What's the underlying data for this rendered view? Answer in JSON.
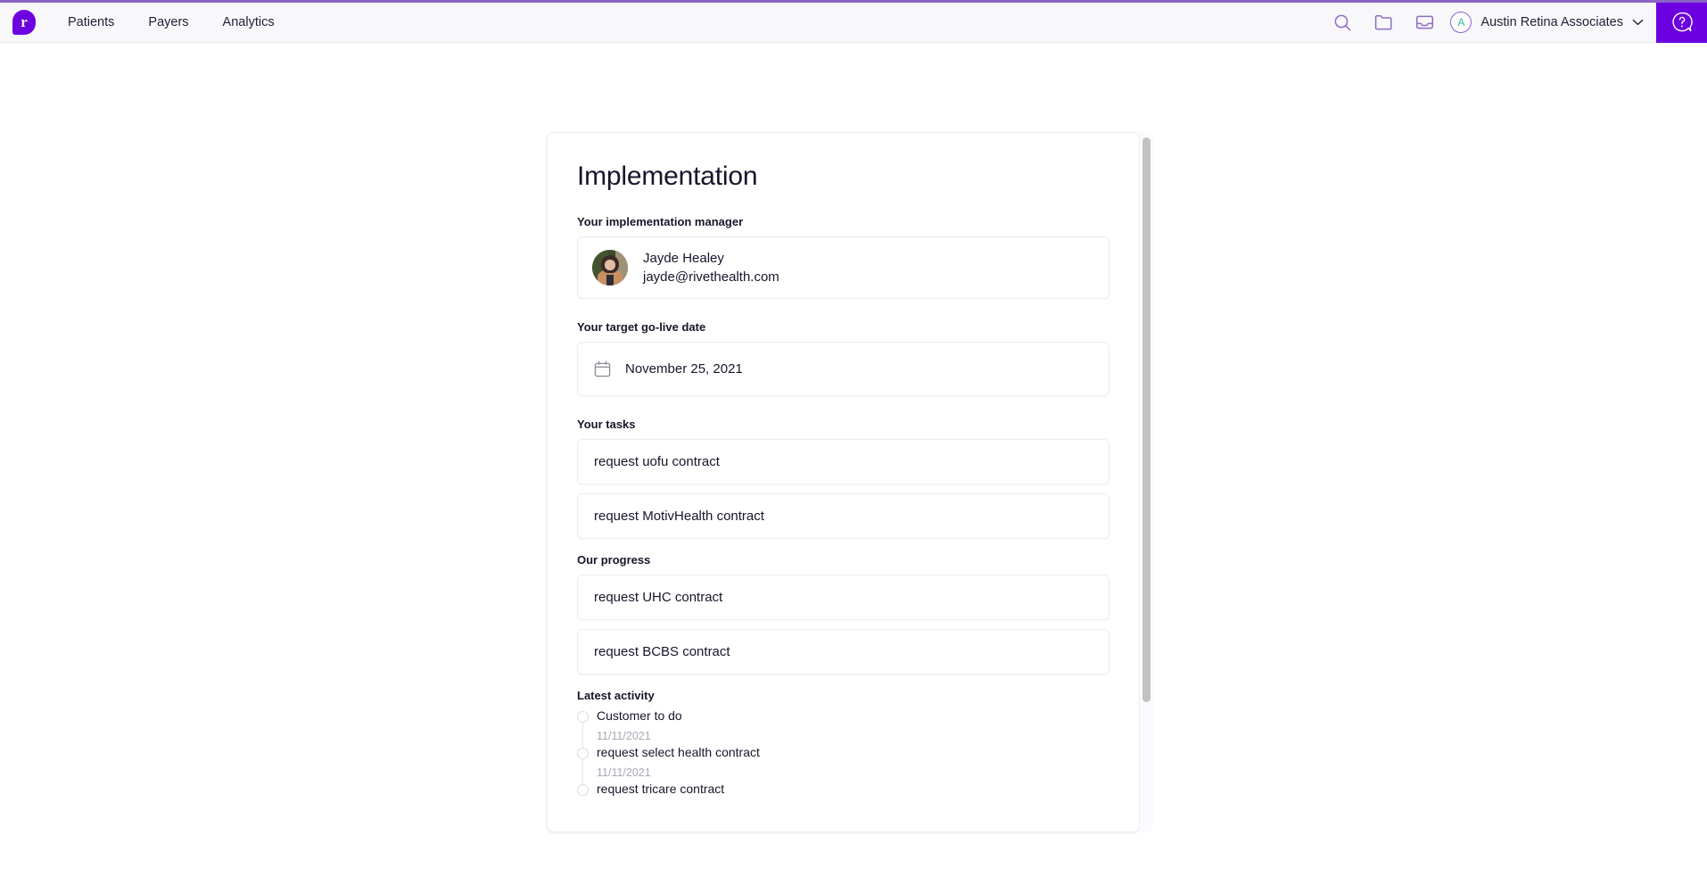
{
  "navbar": {
    "logo_letter": "r",
    "logo_name": "rivet-logo",
    "links": [
      {
        "label": "Patients"
      },
      {
        "label": "Payers"
      },
      {
        "label": "Analytics"
      }
    ],
    "icons": [
      {
        "name": "search-icon"
      },
      {
        "name": "folder-icon"
      },
      {
        "name": "inbox-icon"
      }
    ],
    "account": {
      "initial": "A",
      "name": "Austin Retina Associates"
    },
    "help_label": "?",
    "accent_color": "#6c00e0",
    "top_strip_color": "#8a63c7"
  },
  "card": {
    "title": "Implementation",
    "manager": {
      "label": "Your implementation manager",
      "name": "Jayde Healey",
      "email": "jayde@rivethealth.com"
    },
    "go_live": {
      "label": "Your target go-live date",
      "date": "November 25, 2021"
    },
    "tasks": {
      "label": "Your tasks",
      "items": [
        {
          "text": "request uofu contract"
        },
        {
          "text": "request MotivHealth contract"
        }
      ]
    },
    "progress": {
      "label": "Our progress",
      "items": [
        {
          "text": "request UHC contract"
        },
        {
          "text": "request BCBS contract"
        }
      ]
    },
    "activity": {
      "label": "Latest activity",
      "items": [
        {
          "title": "Customer to do",
          "date": "11/11/2021"
        },
        {
          "title": "request select health contract",
          "date": "11/11/2021"
        },
        {
          "title": "request tricare contract",
          "date": ""
        }
      ]
    }
  }
}
